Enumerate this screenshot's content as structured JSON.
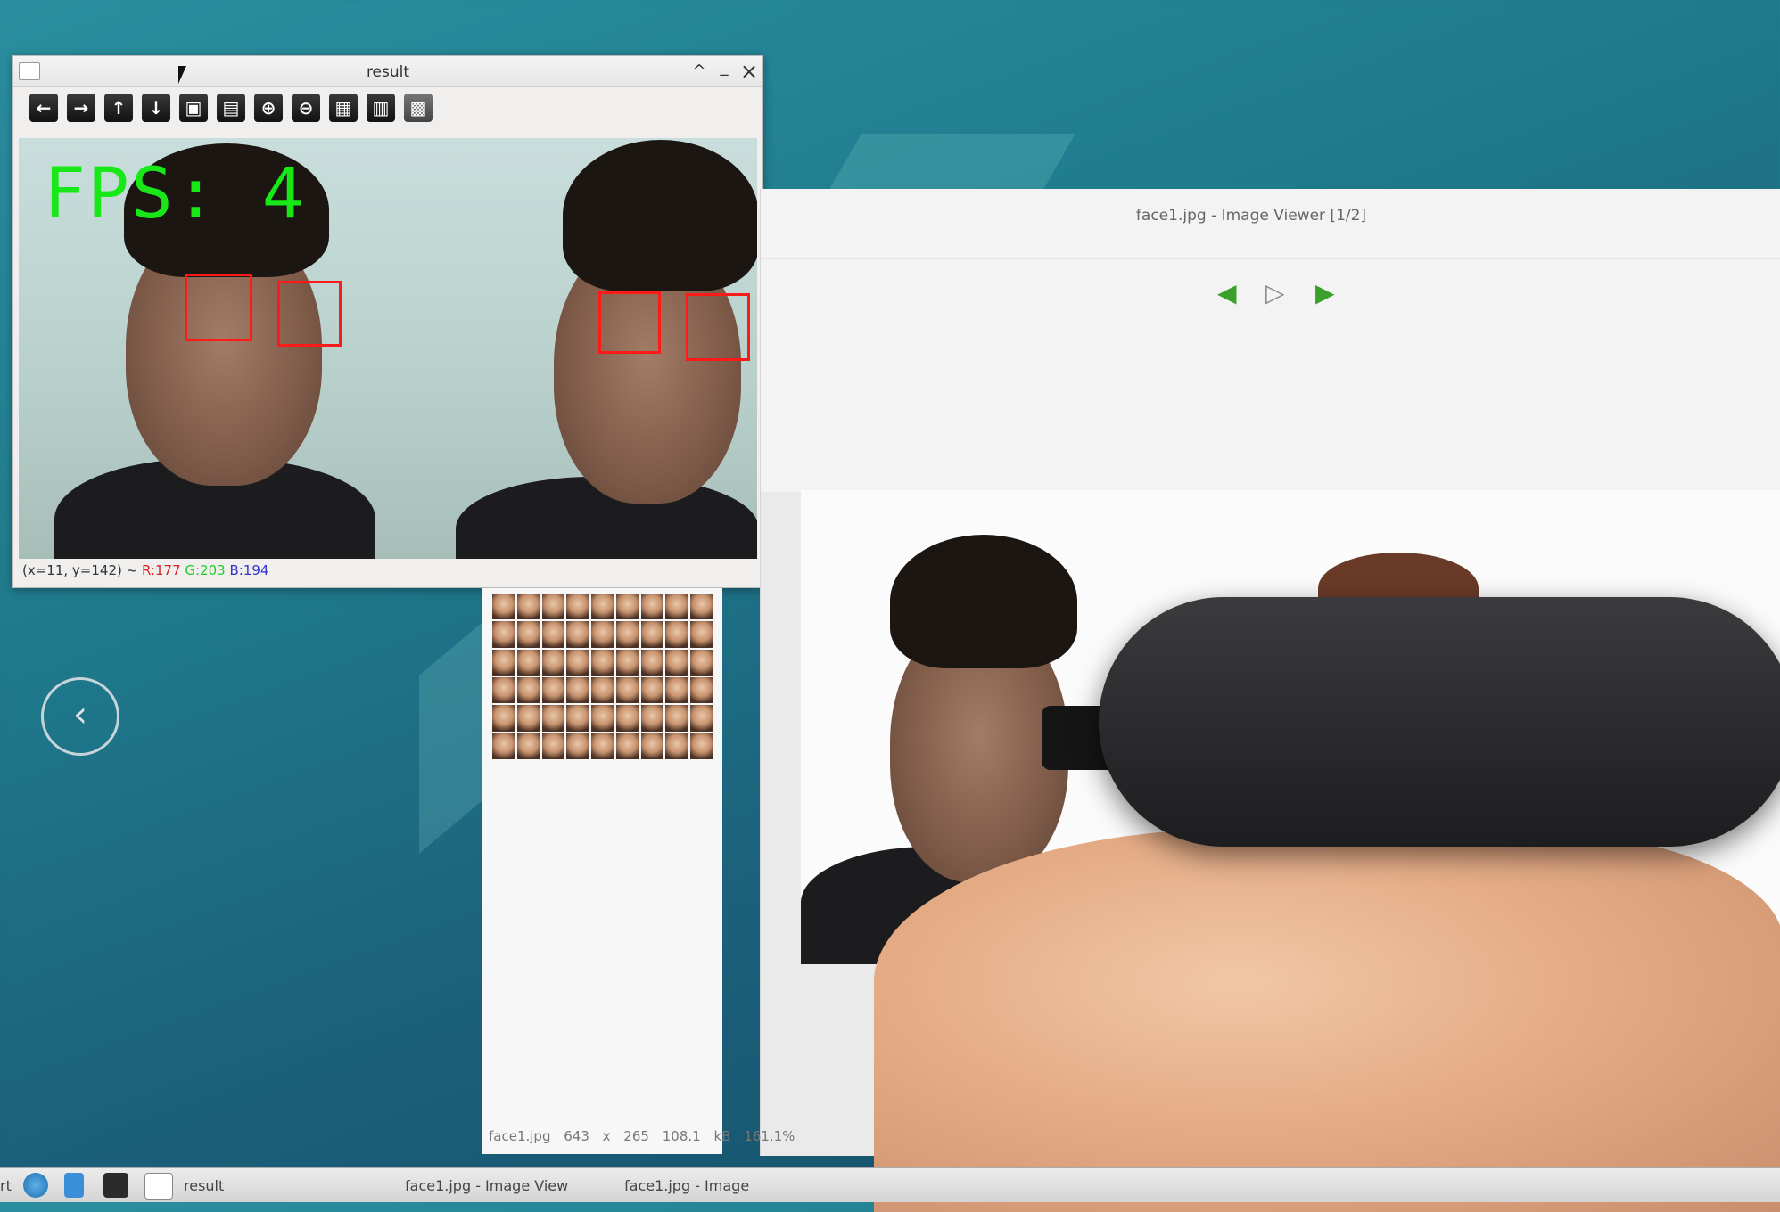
{
  "cv_window": {
    "title": "result",
    "controls": {
      "maximize": "^",
      "minimize": "_",
      "close": "×"
    },
    "toolbar": [
      {
        "name": "pan-left",
        "glyph": "←"
      },
      {
        "name": "pan-right",
        "glyph": "→"
      },
      {
        "name": "pan-up",
        "glyph": "↑"
      },
      {
        "name": "pan-down",
        "glyph": "↓"
      },
      {
        "name": "zoom-fit",
        "glyph": "▣"
      },
      {
        "name": "zoom-original",
        "glyph": "▤"
      },
      {
        "name": "zoom-in",
        "glyph": "⊕"
      },
      {
        "name": "zoom-out",
        "glyph": "⊖"
      },
      {
        "name": "save",
        "glyph": "▦"
      },
      {
        "name": "copy-clipboard",
        "glyph": "▥"
      },
      {
        "name": "properties",
        "glyph": "▩"
      }
    ],
    "overlay_text": "FPS: 4",
    "status": {
      "coords": "(x=11, y=142) ~",
      "r": "R:177",
      "g": "G:203",
      "b": "B:194"
    }
  },
  "image_viewer": {
    "title": "face1.jpg - Image Viewer [1/2]",
    "nav": {
      "prev": "◀",
      "play": "▷",
      "next": "▶"
    },
    "status": {
      "filename": "face1.jpg",
      "dimensions": "643 x 265",
      "filesize": "108.1 kB",
      "zoom": "161.1%"
    }
  },
  "desktop_nav": {
    "left": "‹",
    "right": "›"
  },
  "taskbar": {
    "start_fragment": "rt",
    "items": [
      {
        "label": "result"
      },
      {
        "label": "face1.jpg - Image View"
      },
      {
        "label": "face1.jpg - Image"
      }
    ]
  },
  "colors": {
    "fps_text": "#18e818",
    "eye_box": "#ff1a1a",
    "nav_arrow": "#3aa02b"
  }
}
